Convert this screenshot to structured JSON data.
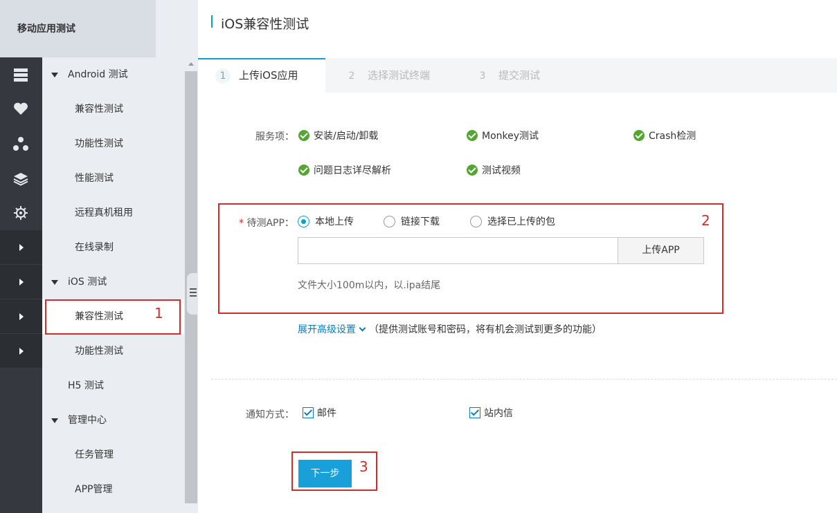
{
  "rail": {
    "top_glyph": "☰",
    "icons": [
      "server-icon",
      "heart-icon",
      "network-icon",
      "layers-icon",
      "gear-icon"
    ]
  },
  "sidebar": {
    "header": "移动应用测试",
    "items": [
      {
        "label": "Android 测试"
      },
      {
        "label": "兼容性测试"
      },
      {
        "label": "功能性测试"
      },
      {
        "label": "性能测试"
      },
      {
        "label": "远程真机租用"
      },
      {
        "label": "在线录制"
      },
      {
        "label": "iOS 测试"
      },
      {
        "label": "兼容性测试"
      },
      {
        "label": "功能性测试"
      },
      {
        "label": "H5 测试"
      },
      {
        "label": "管理中心"
      },
      {
        "label": "任务管理"
      },
      {
        "label": "APP管理"
      }
    ]
  },
  "page": {
    "title": "iOS兼容性测试"
  },
  "steps": [
    {
      "num": "1",
      "label": "上传iOS应用"
    },
    {
      "num": "2",
      "label": "选择测试终端"
    },
    {
      "num": "3",
      "label": "提交测试"
    }
  ],
  "services": {
    "label": "服务项：",
    "items": [
      "安装/启动/卸载",
      "Monkey测试",
      "Crash检测",
      "问题日志详尽解析",
      "测试视频"
    ]
  },
  "app": {
    "required_mark": "*",
    "label": "待测APP：",
    "options": [
      "本地上传",
      "链接下载",
      "选择已上传的包"
    ],
    "selected": "本地上传",
    "upload_button": "上传APP",
    "file_value": "",
    "hint": "文件大小100m以内，以.ipa结尾"
  },
  "advanced": {
    "link": "展开高级设置",
    "note": "（提供测试账号和密码，将有机会测试到更多的功能）"
  },
  "notify": {
    "label": "通知方式：",
    "options": [
      {
        "label": "邮件",
        "checked": true
      },
      {
        "label": "站内信",
        "checked": true
      }
    ]
  },
  "next_button": "下一步",
  "annotations": [
    "1",
    "2",
    "3"
  ],
  "colors": {
    "accent": "#0aa0cc",
    "button": "#1aa0d8",
    "annotation": "#d42a2a",
    "check": "#55a532"
  }
}
